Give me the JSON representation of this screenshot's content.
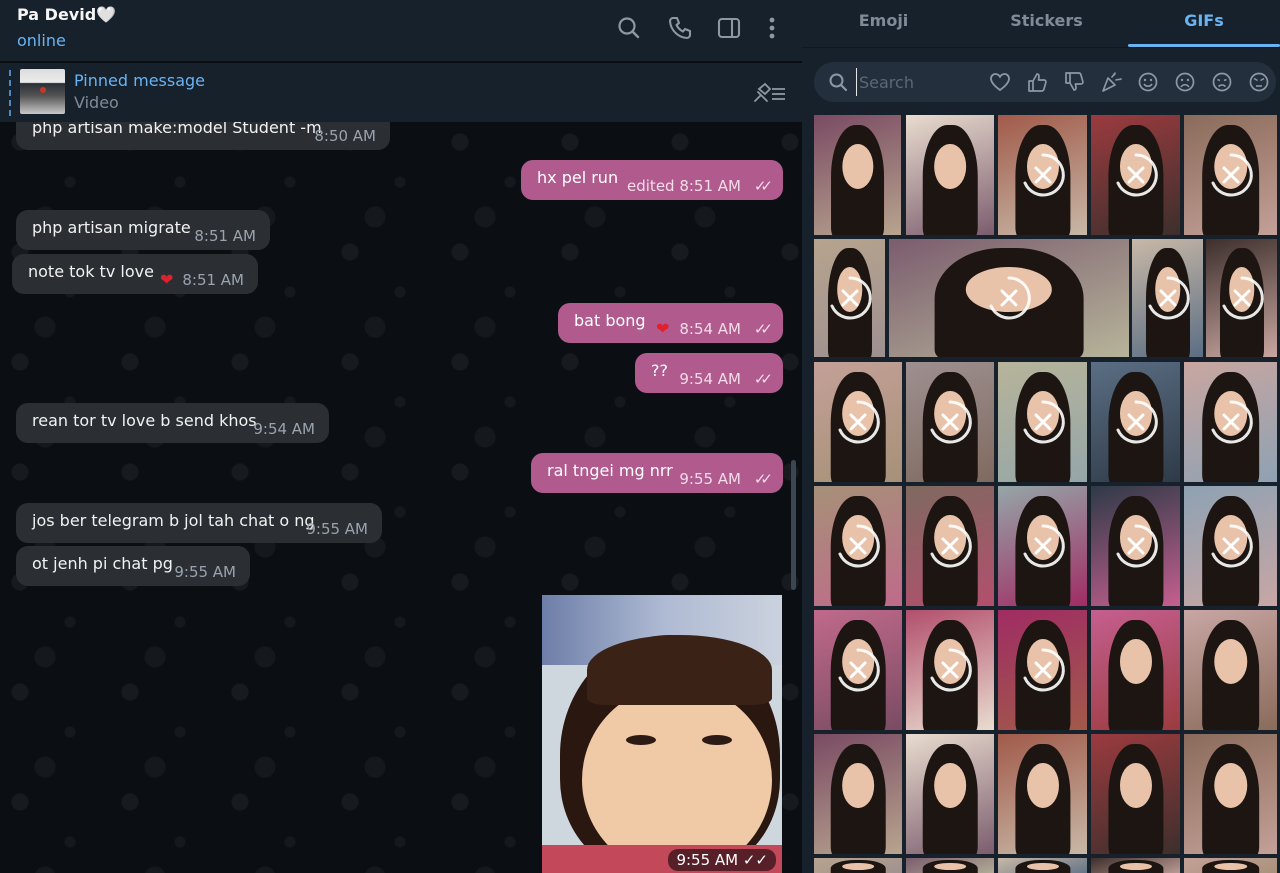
{
  "chat": {
    "contact_name": "Pa Devid🤍",
    "status": "online",
    "pinned": {
      "title": "Pinned message",
      "subtitle": "Video"
    }
  },
  "messages": [
    {
      "dir": "in",
      "text": "php artisan make:model Student -m",
      "time": "8:50 AM"
    },
    {
      "dir": "out",
      "text": "hx pel run",
      "time": "edited 8:51 AM"
    },
    {
      "dir": "in",
      "text": "php artisan migrate",
      "time": "8:51 AM"
    },
    {
      "dir": "in",
      "text": "note tok tv love",
      "time": "8:51 AM",
      "reaction": "❤"
    },
    {
      "dir": "out",
      "text": "bat bong",
      "time": "8:54 AM",
      "reaction": "❤"
    },
    {
      "dir": "out",
      "text": "??",
      "time": "9:54 AM"
    },
    {
      "dir": "in",
      "text": "rean tor tv love b send khos",
      "time": "9:54 AM"
    },
    {
      "dir": "out",
      "text": "ral tngei mg nrr",
      "time": "9:55 AM"
    },
    {
      "dir": "in",
      "text": "jos ber telegram b jol tah chat o ng",
      "time": "9:55 AM"
    },
    {
      "dir": "in",
      "text": "ot jenh pi chat pg",
      "time": "9:55 AM"
    },
    {
      "dir": "out",
      "type": "photo",
      "time": "9:55 AM"
    }
  ],
  "panel": {
    "tabs": [
      "Emoji",
      "Stickers",
      "GIFs"
    ],
    "active_tab": "GIFs",
    "search_placeholder": "Search",
    "filters": [
      "heart-icon",
      "thumbs-up-icon",
      "thumbs-down-icon",
      "party-icon",
      "smile-icon",
      "sad-icon",
      "frown-icon",
      "angry-icon"
    ]
  },
  "colors": {
    "accent": "#6ab3f3",
    "outgoing_bubble": "#b05a8e",
    "incoming_bubble": "#2b2f33",
    "header_bg": "#17212b"
  }
}
